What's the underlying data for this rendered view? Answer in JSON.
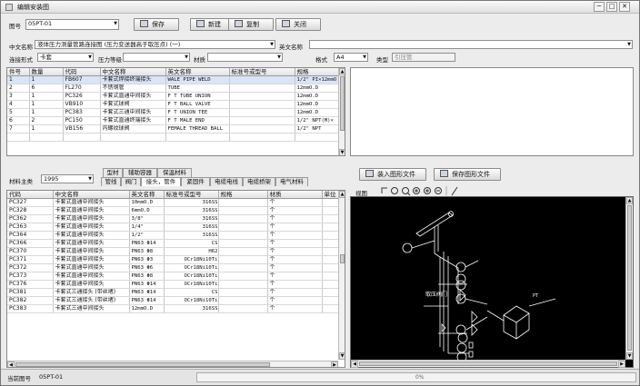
{
  "window": {
    "title": "编辑安装图",
    "btn_min": "─",
    "btn_max": "□",
    "btn_close": "✕"
  },
  "toolbar": {
    "drawing_no_label": "图号",
    "drawing_no_value": "05PT-01",
    "save": "保存",
    "new": "新建",
    "copy": "复制",
    "close": "关闭"
  },
  "form": {
    "cn_name_label": "中文名称",
    "cn_name_value": "液体压力测量管路连接图 (压力变送器高于取压点) (一)",
    "en_name_label": "英文名称",
    "en_name_value": "",
    "conn_label": "连接形式",
    "conn_value": "卡套",
    "pressure_label": "压力等级",
    "pressure_value": "",
    "material_label": "材质",
    "material_value": "",
    "format_label": "格式",
    "format_value": "A4",
    "type_label": "类型",
    "type_value": "引压管"
  },
  "parts": {
    "headers": [
      "件号",
      "数量",
      "代码",
      "中文名称",
      "英文名称",
      "标准号或型号",
      "规格"
    ],
    "rows": [
      [
        "1",
        "1",
        "FB607",
        "卡套式焊接终端接头",
        "WALE PIPE WELD",
        "",
        "1/2\" PI×12mmO"
      ],
      [
        "2",
        "6",
        "FL270",
        "不锈钢管",
        "TUBE",
        "",
        "12mmO.D"
      ],
      [
        "3",
        "1",
        "PC326",
        "卡套式直通中间接头",
        "F T TUBE UNION",
        "",
        "12mmO.D"
      ],
      [
        "4",
        "1",
        "VB910",
        "卡套式球阀",
        "F T BALL VALVE",
        "",
        "12mmO.D"
      ],
      [
        "5",
        "1",
        "PC383",
        "卡套式三通中间接头",
        "F T UNION TEE",
        "",
        "12mmO.D"
      ],
      [
        "6",
        "2",
        "PC150",
        "卡套式直通终端接头",
        "F T MALE END",
        "",
        "1/2\" NPT(M)×"
      ],
      [
        "7",
        "1",
        "VB156",
        "内螺纹球阀",
        "FEMALE THREAD BALL",
        "",
        "1/2\" NPT"
      ]
    ]
  },
  "catalog": {
    "main_category_label": "材料主类",
    "main_category_value": "1995",
    "tabs_row1": [
      "型材",
      "辅助容器",
      "保温材料"
    ],
    "tabs_row2": [
      "管线",
      "阀门",
      "接头，管件",
      "紧固件",
      "电缆电线",
      "电缆桥架",
      "电气材料"
    ],
    "headers": [
      "代码",
      "中文名称",
      "英文名称",
      "标准号或型号",
      "规格",
      "材质",
      "单位"
    ],
    "rows": [
      [
        "PC327",
        "卡套式直通中间接头",
        "10mmO.D",
        "316SS",
        "",
        "个",
        ""
      ],
      [
        "PC328",
        "卡套式直通中间接头",
        "6mmO.D",
        "316SS",
        "",
        "个",
        ""
      ],
      [
        "PC362",
        "卡套式直通中间接头",
        "3/8\"",
        "316SS",
        "",
        "个",
        ""
      ],
      [
        "PC363",
        "卡套式直通中间接头",
        "1/4\"",
        "316SS",
        "",
        "个",
        ""
      ],
      [
        "PC364",
        "卡套式直通中间接头",
        "1/2\"",
        "316SS",
        "",
        "个",
        ""
      ],
      [
        "PC366",
        "卡套式直通中间接头",
        "PN63 Φ14",
        "CS",
        "",
        "个",
        ""
      ],
      [
        "PC370",
        "卡套式直通中间接头",
        "PN63 Φ8",
        "H62",
        "",
        "个",
        ""
      ],
      [
        "PC371",
        "卡套式直通中间接头",
        "PN63 Φ3",
        "OCr18Ni10Ti",
        "",
        "个",
        ""
      ],
      [
        "PC372",
        "卡套式直通中间接头",
        "PN63 Φ6",
        "OCr18Ni10Ti",
        "",
        "个",
        ""
      ],
      [
        "PC373",
        "卡套式直通中间接头",
        "PN63 Φ8",
        "OCr18Ni10Ti",
        "",
        "个",
        ""
      ],
      [
        "PC376",
        "卡套式直通中间接头",
        "PN63 Φ14",
        "OCr18Ni10Ti",
        "",
        "个",
        ""
      ],
      [
        "PC381",
        "卡套式三通接头 (带丝堵)",
        "PN63 Φ14",
        "CS",
        "",
        "个",
        ""
      ],
      [
        "PC382",
        "卡套式三通接头 (带丝堵)",
        "PN63 Φ14",
        "OCr18Ni10Ti",
        "",
        "个",
        ""
      ],
      [
        "PC383",
        "卡套式三通中间接头",
        "12mmO.D",
        "316SS",
        "",
        "个",
        ""
      ]
    ]
  },
  "viewer": {
    "import_label": "装入图形文件",
    "save_label": "保存图形文件",
    "view_label": "视图",
    "drawing_text": "取压阀门"
  },
  "status": {
    "current_label": "当前图号",
    "current_value": "05PT-01",
    "progress_text": "0%"
  }
}
